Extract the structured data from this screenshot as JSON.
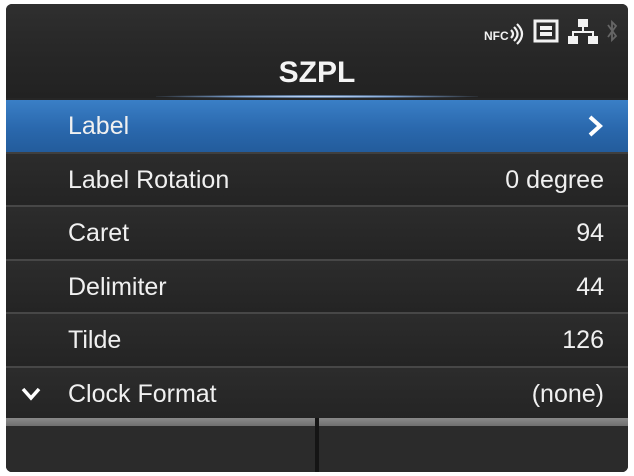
{
  "screen": {
    "title": "SZPL",
    "status_icons": {
      "nfc_label": "NFC",
      "nfc": "nfc-icon",
      "sd_card": "sd-card-icon",
      "network": "network-icon",
      "bluetooth": "bluetooth-icon"
    }
  },
  "menu": {
    "items": [
      {
        "label": "Label",
        "value": "",
        "selected": true,
        "has_submenu": true
      },
      {
        "label": "Label Rotation",
        "value": "0 degree",
        "selected": false
      },
      {
        "label": "Caret",
        "value": "94",
        "selected": false
      },
      {
        "label": "Delimiter",
        "value": "44",
        "selected": false
      },
      {
        "label": "Tilde",
        "value": "126",
        "selected": false
      },
      {
        "label": "Clock Format",
        "value": "(none)",
        "selected": false,
        "more_below": true
      }
    ]
  },
  "softkeys": {
    "left_label": "",
    "right_label": ""
  },
  "colors": {
    "screen_bg": "#262626",
    "selected_row": "#2a68ad",
    "text": "#f0f0f0",
    "softkey_bar": "#7a7a7a"
  }
}
